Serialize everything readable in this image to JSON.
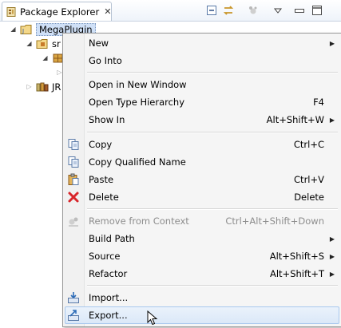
{
  "view": {
    "title": "Package Explorer",
    "close_glyph": "✕",
    "toolbar_icons": [
      "collapse-all-icon",
      "link-with-editor-icon",
      "focus-icon",
      "view-menu-icon",
      "minimize-icon",
      "maximize-icon"
    ]
  },
  "tree": {
    "project": {
      "label": "MegaPlugin",
      "expanded": true
    },
    "nodes": [
      {
        "label": "sr",
        "icon": "source-folder-icon"
      },
      {
        "label": "",
        "icon": "package-icon"
      },
      {
        "label": "",
        "icon": "collapsed-node"
      },
      {
        "label": "JR",
        "icon": "library-icon"
      }
    ]
  },
  "context_menu": {
    "items": [
      {
        "label": "New",
        "shortcut": "",
        "submenu": true,
        "icon": "",
        "enabled": true
      },
      {
        "label": "Go Into",
        "shortcut": "",
        "submenu": false,
        "icon": "",
        "enabled": true
      },
      {
        "label": "Open in New Window",
        "shortcut": "",
        "submenu": false,
        "icon": "",
        "enabled": true
      },
      {
        "label": "Open Type Hierarchy",
        "shortcut": "F4",
        "submenu": false,
        "icon": "",
        "enabled": true
      },
      {
        "label": "Show In",
        "shortcut": "Alt+Shift+W",
        "submenu": true,
        "icon": "",
        "enabled": true
      },
      {
        "label": "Copy",
        "shortcut": "Ctrl+C",
        "submenu": false,
        "icon": "copy-icon",
        "enabled": true
      },
      {
        "label": "Copy Qualified Name",
        "shortcut": "",
        "submenu": false,
        "icon": "copy-qualified-icon",
        "enabled": true
      },
      {
        "label": "Paste",
        "shortcut": "Ctrl+V",
        "submenu": false,
        "icon": "paste-icon",
        "enabled": true
      },
      {
        "label": "Delete",
        "shortcut": "Delete",
        "submenu": false,
        "icon": "delete-icon",
        "enabled": true
      },
      {
        "label": "Remove from Context",
        "shortcut": "Ctrl+Alt+Shift+Down",
        "submenu": false,
        "icon": "remove-context-icon",
        "enabled": false
      },
      {
        "label": "Build Path",
        "shortcut": "",
        "submenu": true,
        "icon": "",
        "enabled": true
      },
      {
        "label": "Source",
        "shortcut": "Alt+Shift+S",
        "submenu": true,
        "icon": "",
        "enabled": true
      },
      {
        "label": "Refactor",
        "shortcut": "Alt+Shift+T",
        "submenu": true,
        "icon": "",
        "enabled": true
      },
      {
        "label": "Import...",
        "shortcut": "",
        "submenu": false,
        "icon": "import-icon",
        "enabled": true
      },
      {
        "label": "Export...",
        "shortcut": "",
        "submenu": false,
        "icon": "export-icon",
        "enabled": true,
        "hovered": true
      }
    ],
    "submenu_arrow": "▶"
  },
  "colors": {
    "selection": "#cfe0f7",
    "hover": "#dbe8f8",
    "delete_red": "#d8262b"
  }
}
